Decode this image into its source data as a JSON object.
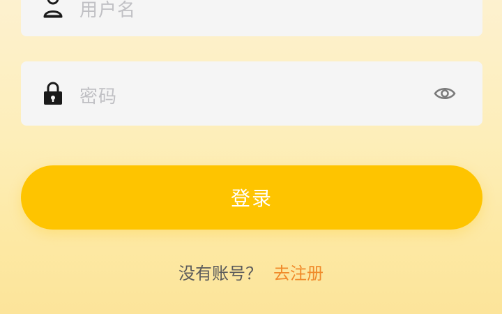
{
  "username": {
    "placeholder": "用户名",
    "icon": "user-icon"
  },
  "password": {
    "placeholder": "密码",
    "icon": "lock-icon",
    "toggle_icon": "eye-icon"
  },
  "login": {
    "label": "登录",
    "color": "#fec400"
  },
  "register": {
    "question": "没有账号？",
    "link": "去注册",
    "link_color": "#f08a2a"
  }
}
